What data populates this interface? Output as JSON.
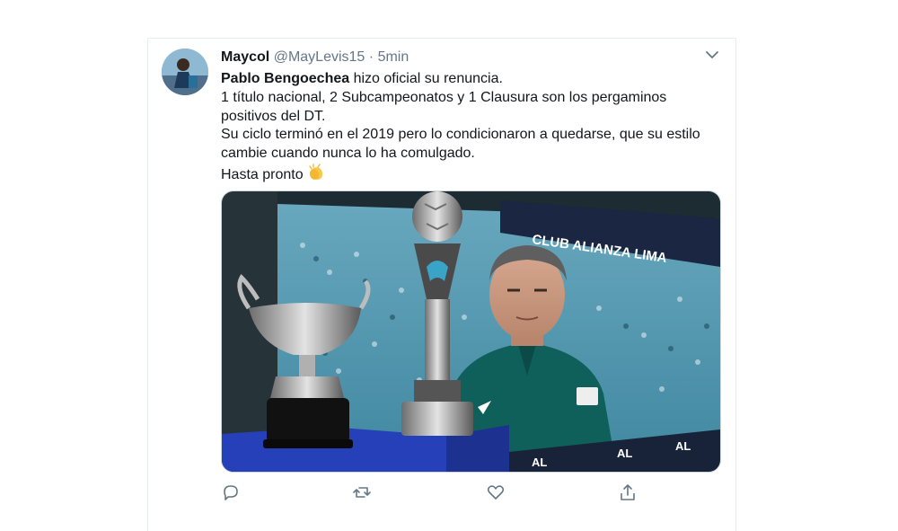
{
  "tweet": {
    "author_name": "Maycol",
    "handle": "@MayLevis15",
    "separator": "·",
    "time": "5min",
    "line1_bold": "Pablo Bengoechea",
    "line1_rest": " hizo oficial su renuncia.",
    "line2": "1 título nacional, 2 Subcampeonatos y 1 Clausura son los pergaminos positivos del DT.",
    "line3": "Su ciclo terminó en el 2019 pero lo condicionaron a quedarse, que su estilo cambie cuando nunca lo ha comulgado.",
    "line4": "Hasta pronto",
    "emoji": "clapping-hands"
  },
  "media": {
    "banner_text": "CLUB ALIANZA LIMA",
    "ad_text": "AL"
  },
  "actions": [
    "reply-icon",
    "retweet-icon",
    "like-icon",
    "share-icon"
  ],
  "colors": {
    "text": "#14171a",
    "secondary": "#657786",
    "border": "#e6ecf0",
    "stadium_teal": "#3a8fa8",
    "jacket": "#0f5f5a",
    "pedestal_blue": "#2540b8"
  }
}
